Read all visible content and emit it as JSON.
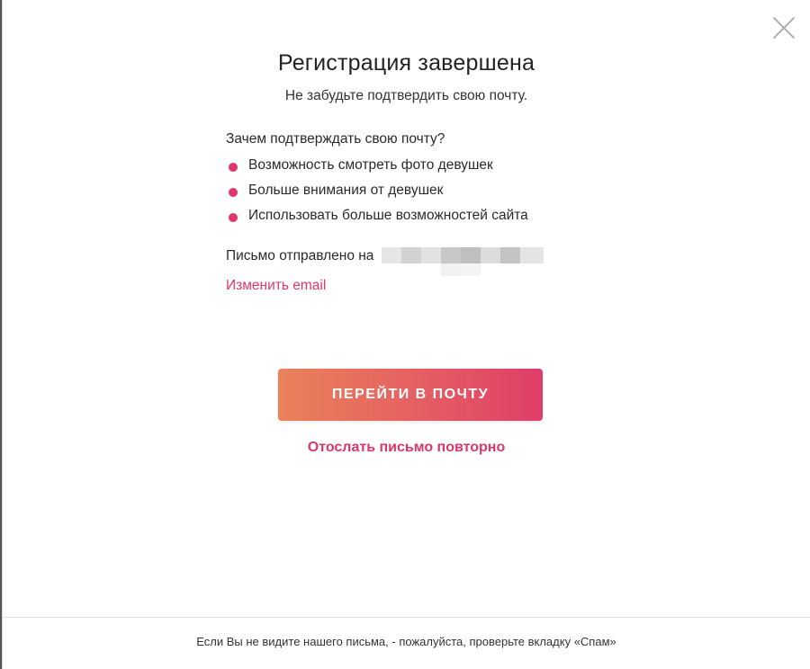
{
  "dialog": {
    "title": "Регистрация завершена",
    "subtitle": "Не забудьте подтвердить свою почту.",
    "question": "Зачем подтверждать свою почту?",
    "benefits": [
      {
        "label": "Возможность смотреть фото девушек"
      },
      {
        "label": "Больше внимания от девушек"
      },
      {
        "label": "Использовать больше возможностей сайта"
      }
    ],
    "sent_label": "Письмо отправлено на",
    "change_email_label": "Изменить email",
    "primary_button_label": "ПЕРЕЙТИ В ПОЧТУ",
    "resend_label": "Отослать письмо повторно",
    "footer_note": "Если Вы не видите нашего письма, - пожалуйста, проверьте вкладку «Спам»"
  },
  "icons": {
    "close": "close-icon",
    "bullet": "bullet-dot-icon"
  },
  "colors": {
    "accent": "#e0366b",
    "button_gradient_start": "#ea8259",
    "button_gradient_end": "#df3d68",
    "text": "#222222",
    "divider": "#dcdcdc"
  }
}
